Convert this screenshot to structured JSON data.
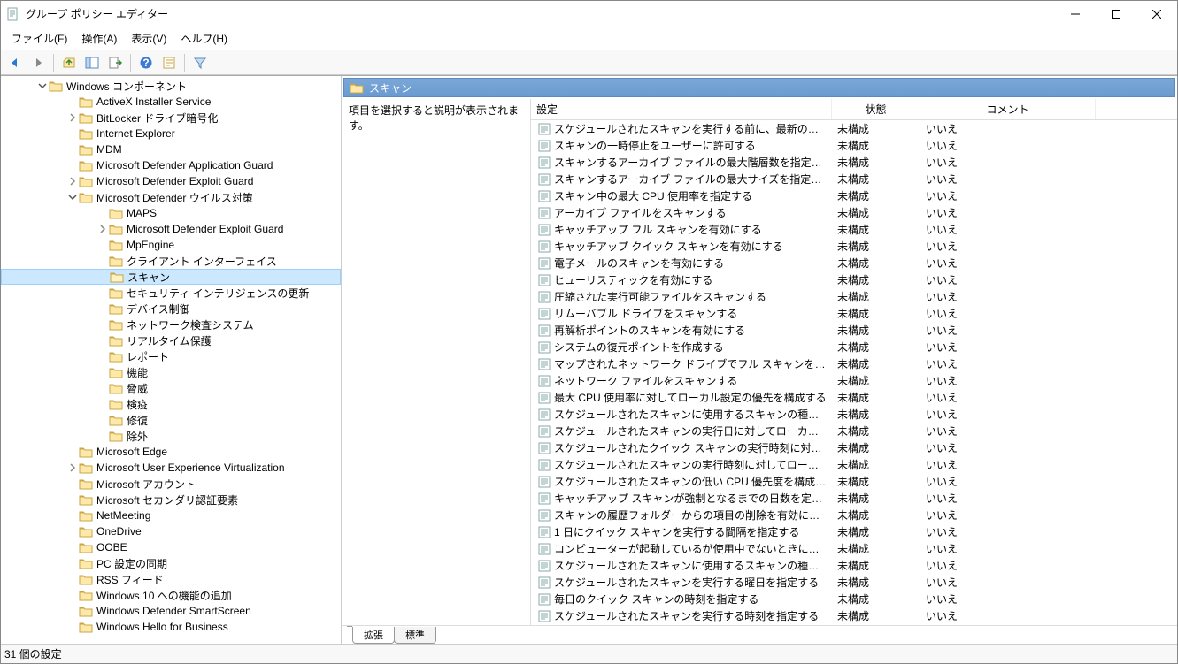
{
  "window": {
    "title": "グループ ポリシー エディター"
  },
  "menu": {
    "file": "ファイル(F)",
    "action": "操作(A)",
    "view": "表示(V)",
    "help": "ヘルプ(H)"
  },
  "pane_header": "スキャン",
  "desc_text": "項目を選択すると説明が表示されます。",
  "columns": {
    "setting": "設定",
    "state": "状態",
    "comment": "コメント"
  },
  "tabs": {
    "ext": "拡張",
    "std": "標準"
  },
  "status": "31 個の設定",
  "state_default": "未構成",
  "comment_default": "いいえ",
  "tree": [
    {
      "indent": 40,
      "exp": "down",
      "label": "Windows コンポーネント"
    },
    {
      "indent": 74,
      "exp": "",
      "label": "ActiveX Installer Service"
    },
    {
      "indent": 74,
      "exp": "right",
      "label": "BitLocker ドライブ暗号化"
    },
    {
      "indent": 74,
      "exp": "",
      "label": "Internet Explorer"
    },
    {
      "indent": 74,
      "exp": "",
      "label": "MDM"
    },
    {
      "indent": 74,
      "exp": "",
      "label": "Microsoft Defender Application Guard"
    },
    {
      "indent": 74,
      "exp": "right",
      "label": "Microsoft Defender Exploit Guard"
    },
    {
      "indent": 74,
      "exp": "down",
      "label": "Microsoft Defender ウイルス対策"
    },
    {
      "indent": 108,
      "exp": "",
      "label": "MAPS"
    },
    {
      "indent": 108,
      "exp": "right",
      "label": "Microsoft Defender Exploit Guard"
    },
    {
      "indent": 108,
      "exp": "",
      "label": "MpEngine"
    },
    {
      "indent": 108,
      "exp": "",
      "label": "クライアント インターフェイス"
    },
    {
      "indent": 108,
      "exp": "",
      "label": "スキャン",
      "selected": true
    },
    {
      "indent": 108,
      "exp": "",
      "label": "セキュリティ インテリジェンスの更新"
    },
    {
      "indent": 108,
      "exp": "",
      "label": "デバイス制御"
    },
    {
      "indent": 108,
      "exp": "",
      "label": "ネットワーク検査システム"
    },
    {
      "indent": 108,
      "exp": "",
      "label": "リアルタイム保護"
    },
    {
      "indent": 108,
      "exp": "",
      "label": "レポート"
    },
    {
      "indent": 108,
      "exp": "",
      "label": "機能"
    },
    {
      "indent": 108,
      "exp": "",
      "label": "脅威"
    },
    {
      "indent": 108,
      "exp": "",
      "label": "検疫"
    },
    {
      "indent": 108,
      "exp": "",
      "label": "修復"
    },
    {
      "indent": 108,
      "exp": "",
      "label": "除外"
    },
    {
      "indent": 74,
      "exp": "",
      "label": "Microsoft Edge"
    },
    {
      "indent": 74,
      "exp": "right",
      "label": "Microsoft User Experience Virtualization"
    },
    {
      "indent": 74,
      "exp": "",
      "label": "Microsoft アカウント"
    },
    {
      "indent": 74,
      "exp": "",
      "label": "Microsoft セカンダリ認証要素"
    },
    {
      "indent": 74,
      "exp": "",
      "label": "NetMeeting"
    },
    {
      "indent": 74,
      "exp": "",
      "label": "OneDrive"
    },
    {
      "indent": 74,
      "exp": "",
      "label": "OOBE"
    },
    {
      "indent": 74,
      "exp": "",
      "label": "PC 設定の同期"
    },
    {
      "indent": 74,
      "exp": "",
      "label": "RSS フィード"
    },
    {
      "indent": 74,
      "exp": "",
      "label": "Windows 10 への機能の追加"
    },
    {
      "indent": 74,
      "exp": "",
      "label": "Windows Defender SmartScreen"
    },
    {
      "indent": 74,
      "exp": "",
      "label": "Windows Hello for Business"
    }
  ],
  "settings": [
    "スケジュールされたスキャンを実行する前に、最新のウイルスおよびスパ...",
    "スキャンの一時停止をユーザーに許可する",
    "スキャンするアーカイブ ファイルの最大階層数を指定する",
    "スキャンするアーカイブ ファイルの最大サイズを指定する",
    "スキャン中の最大 CPU 使用率を指定する",
    "アーカイブ ファイルをスキャンする",
    "キャッチアップ フル スキャンを有効にする",
    "キャッチアップ クイック スキャンを有効にする",
    "電子メールのスキャンを有効にする",
    "ヒューリスティックを有効にする",
    "圧縮された実行可能ファイルをスキャンする",
    "リムーバブル ドライブをスキャンする",
    "再解析ポイントのスキャンを有効にする",
    "システムの復元ポイントを作成する",
    "マップされたネットワーク ドライブでフル スキャンを実行する",
    "ネットワーク ファイルをスキャンする",
    "最大 CPU 使用率に対してローカル設定の優先を構成する",
    "スケジュールされたスキャンに使用するスキャンの種類に対してローカル...",
    "スケジュールされたスキャンの実行日に対してローカル設定の優先を構...",
    "スケジュールされたクイック スキャンの実行時刻に対してローカル設定...",
    "スケジュールされたスキャンの実行時刻に対してローカル設定の優先を...",
    "スケジュールされたスキャンの低い CPU 優先度を構成する",
    "キャッチアップ スキャンが強制となるまでの日数を定義する",
    "スキャンの履歴フォルダーからの項目の削除を有効にする",
    "1 日にクイック スキャンを実行する間隔を指定する",
    "コンピューターが起動しているが使用中でないときにのみスケジュールさ...",
    "スケジュールされたスキャンに使用するスキャンの種類を指定する",
    "スケジュールされたスキャンを実行する曜日を指定する",
    "毎日のクイック スキャンの時刻を指定する",
    "スケジュールされたスキャンを実行する時刻を指定する"
  ]
}
